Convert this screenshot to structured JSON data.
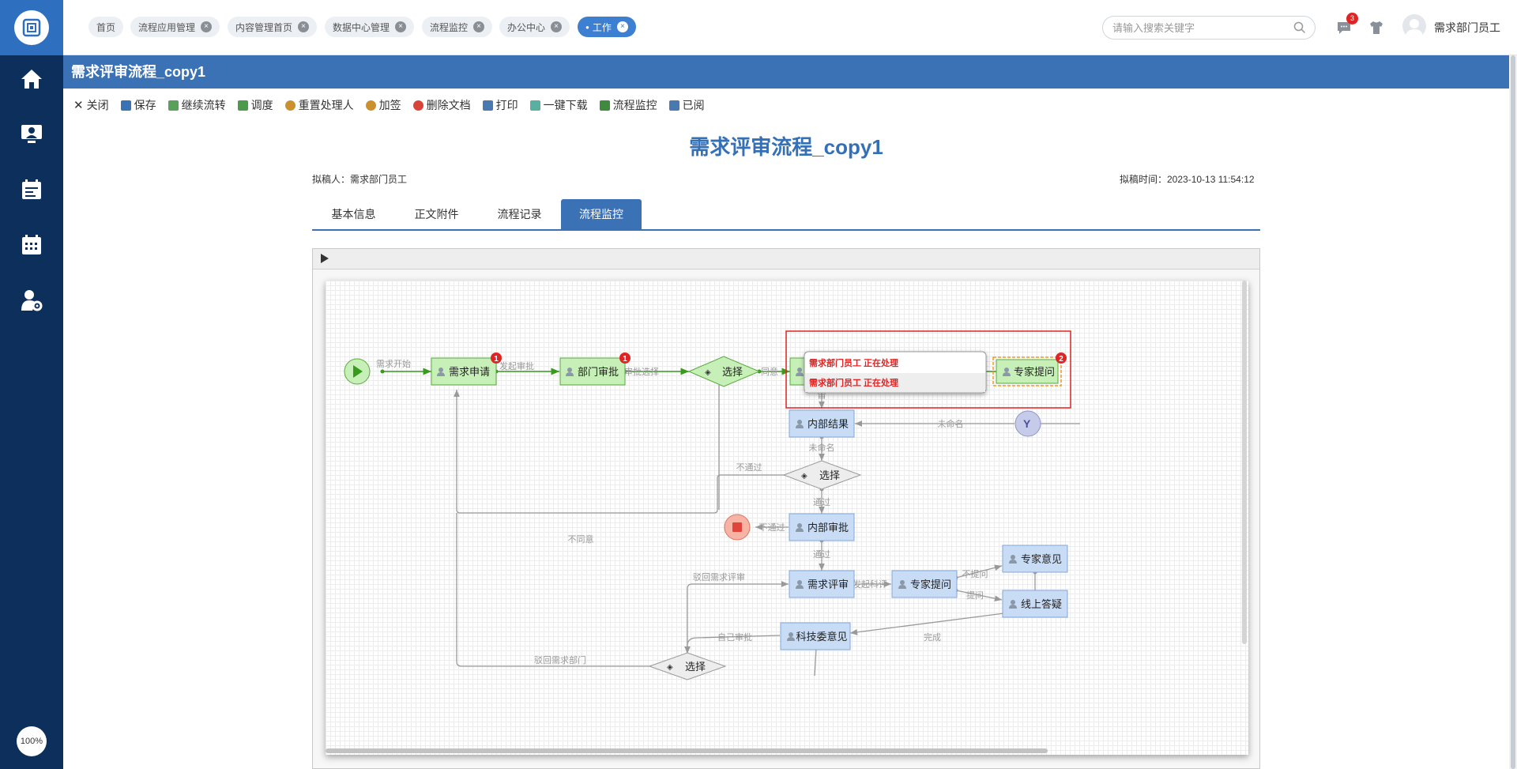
{
  "header": {
    "tabs": [
      {
        "label": "首页",
        "closable": false
      },
      {
        "label": "流程应用管理",
        "closable": true
      },
      {
        "label": "内容管理首页",
        "closable": true
      },
      {
        "label": "数据中心管理",
        "closable": true
      },
      {
        "label": "流程监控",
        "closable": true
      },
      {
        "label": "办公中心",
        "closable": true
      },
      {
        "label": "工作",
        "closable": true,
        "active": true
      }
    ],
    "search_placeholder": "请输入搜索关键字",
    "message_count": "3",
    "username": "需求部门员工"
  },
  "sidebar": {
    "items": [
      {
        "icon": "home-icon"
      },
      {
        "icon": "monitor-user-icon"
      },
      {
        "icon": "calendar-list-icon"
      },
      {
        "icon": "calendar-grid-icon"
      },
      {
        "icon": "user-settings-icon"
      }
    ],
    "zoom": "100%"
  },
  "page": {
    "title": "需求评审流程_copy1",
    "doc_title": "需求评审流程_copy1",
    "drafter": "拟稿人：需求部门员工",
    "draft_time": "拟稿时间：2023-10-13 11:54:12"
  },
  "toolbar": {
    "buttons": [
      {
        "label": "关闭",
        "icon": "close-icon",
        "color": "#333333"
      },
      {
        "label": "保存",
        "icon": "save-icon",
        "color": "#3b72b6"
      },
      {
        "label": "继续流转",
        "icon": "forward-icon",
        "color": "#5aa05a"
      },
      {
        "label": "调度",
        "icon": "dispatch-icon",
        "color": "#4c9a4c"
      },
      {
        "label": "重置处理人",
        "icon": "reset-user-icon",
        "color": "#c9922e"
      },
      {
        "label": "加签",
        "icon": "add-sign-icon",
        "color": "#c9922e"
      },
      {
        "label": "删除文档",
        "icon": "delete-icon",
        "color": "#d9443a"
      },
      {
        "label": "打印",
        "icon": "print-icon",
        "color": "#4a78b0"
      },
      {
        "label": "一键下载",
        "icon": "download-icon",
        "color": "#5ab0a0"
      },
      {
        "label": "流程监控",
        "icon": "monitor-icon",
        "color": "#3f8a3f"
      },
      {
        "label": "已阅",
        "icon": "read-icon",
        "color": "#4a78b0"
      }
    ]
  },
  "doc_tabs": [
    {
      "label": "基本信息"
    },
    {
      "label": "正文附件"
    },
    {
      "label": "流程记录"
    },
    {
      "label": "流程监控",
      "active": true
    }
  ],
  "flow": {
    "nodes": {
      "xuqiu_shenqing": "需求申请",
      "bumen_shenpi": "部门审批",
      "xuanze_1": "选择",
      "zhuanjia_tiwen_top": "专家提问",
      "neibu_jieguo": "内部结果",
      "xuanze_2": "选择",
      "neibu_shenpi": "内部审批",
      "xuqiu_pingshen": "需求评审",
      "zhuanjia_tiwen": "专家提问",
      "zhuanjia_yijian": "专家意见",
      "xianshang_dayi": "线上答疑",
      "kejiwei_yijian": "科技委意见",
      "xuanze_3": "选择"
    },
    "edges": {
      "xuqiu_kaishi": "需求开始",
      "faqi_shenpi": "发起审批",
      "shenpi_xuanze": "审批选择",
      "tongyi": "同意",
      "shen": "审",
      "weimingming_1": "未命名",
      "weimingming_2": "未命名",
      "butongguo_1": "不通过",
      "tongguo_1": "通过",
      "butongguo_2": "不通过",
      "tongguo_2": "通过",
      "butongyi": "不同意",
      "bohui_xuqiu": "驳回需求评审",
      "faqi_pingshen": "发起科评",
      "butiwen": "不提问",
      "tiwen": "提问",
      "ziji_shenpi": "自己审批",
      "wancheng": "完成",
      "bohui_bumen": "驳回需求部门"
    },
    "badges": {
      "xuqiu_shenqing": "1",
      "bumen_shenpi": "1",
      "zhuanjia_tiwen_top": "2"
    },
    "tooltip": [
      "需求部门员工 正在处理",
      "需求部门员工 正在处理"
    ]
  },
  "colors": {
    "brand": "#3b72b6",
    "sidebar": "#0d2f5c",
    "done_fill": "#c7f0b8",
    "done_stroke": "#5aa83c",
    "todo_fill": "#c8dcf6",
    "todo_stroke": "#7fa7d8",
    "highlight_red": "#e02424"
  }
}
